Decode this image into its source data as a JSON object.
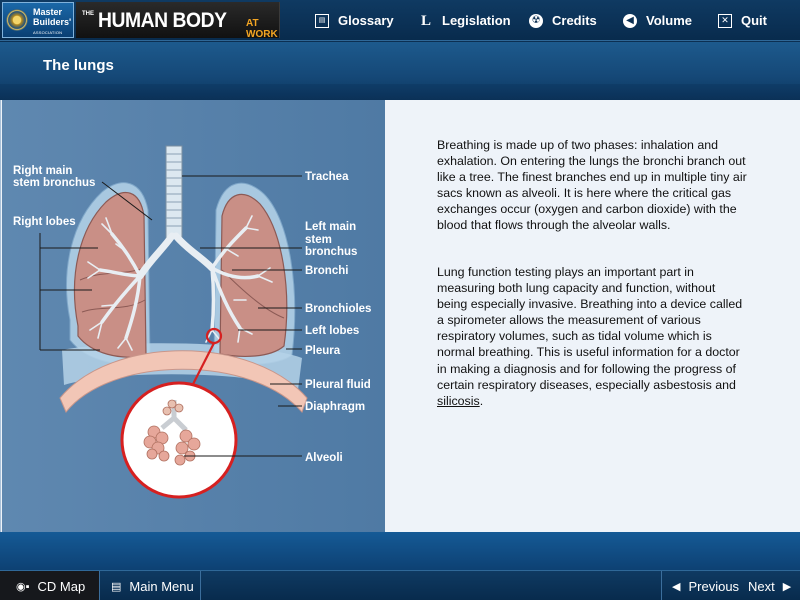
{
  "header": {
    "logo_line1": "Master",
    "logo_line2": "Builders'",
    "logo_line3": "ASSOCIATION",
    "product_prefix": "THE",
    "product_title": "HUMAN BODY",
    "product_suffix": "AT WORK",
    "nav": [
      {
        "label": "Glossary",
        "icon": "glossary-icon"
      },
      {
        "label": "Legislation",
        "icon": "legislation-icon"
      },
      {
        "label": "Credits",
        "icon": "credits-icon"
      },
      {
        "label": "Volume",
        "icon": "volume-icon"
      },
      {
        "label": "Quit",
        "icon": "quit-icon"
      }
    ]
  },
  "page": {
    "title": "The lungs"
  },
  "diagram": {
    "labels": {
      "right_main_1": "Right main",
      "right_main_2": "stem bronchus",
      "right_lobes": "Right lobes",
      "trachea": "Trachea",
      "left_main_1": "Left main",
      "left_main_2": "stem",
      "left_main_3": "bronchus",
      "bronchi": "Bronchi",
      "bronchioles": "Bronchioles",
      "left_lobes": "Left lobes",
      "pleura": "Pleura",
      "pleural_fluid": "Pleural fluid",
      "diaphragm": "Diaphragm",
      "alveoli": "Alveoli"
    }
  },
  "text": {
    "para1": "Breathing is made up of two phases: inhalation and exhalation. On entering the lungs the bronchi branch out like a tree. The finest branches end up in multiple tiny air sacs known as alveoli. It is here where the critical gas exchanges occur (oxygen and carbon dioxide) with the blood that flows through the alveolar walls.",
    "para2_before": "Lung function testing plays an important part in measuring both lung capacity and function, without being especially invasive. Breathing into a device called a spirometer allows the measurement of various respiratory volumes, such as tidal volume which is normal breathing. This is useful information for a doctor in making a diagnosis and for following the progress of certain respiratory diseases, especially asbestosis and ",
    "para2_link": "silicosis",
    "para2_after": "."
  },
  "footer": {
    "cd_map": "CD Map",
    "main_menu": "Main Menu",
    "previous": "Previous",
    "next": "Next"
  },
  "colors": {
    "header_bg": "#0b2f52",
    "diagram_bg": "#5f88b0",
    "lung": "#c98f86",
    "pleura": "#a8c8e0",
    "diaphragm": "#f2c6b6",
    "accent_red": "#d62020"
  }
}
